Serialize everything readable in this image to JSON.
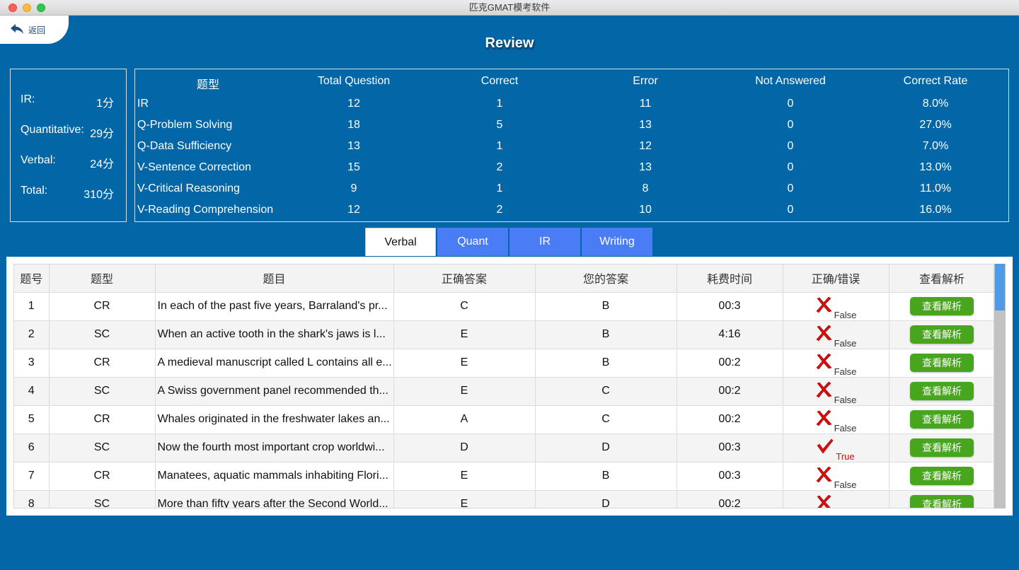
{
  "window": {
    "title": "匹克GMAT模考软件"
  },
  "back": {
    "label": "返回"
  },
  "page": {
    "title": "Review"
  },
  "scores": [
    {
      "label": "IR:",
      "value": "1分"
    },
    {
      "label": "Quantitative:",
      "value": "29分"
    },
    {
      "label": "Verbal:",
      "value": "24分"
    },
    {
      "label": "Total:",
      "value": "310分"
    }
  ],
  "stats": {
    "headers": [
      "题型",
      "Total Question",
      "Correct",
      "Error",
      "Not Answered",
      "Correct Rate"
    ],
    "rows": [
      [
        "IR",
        "12",
        "1",
        "11",
        "0",
        "8.0%"
      ],
      [
        "Q-Problem Solving",
        "18",
        "5",
        "13",
        "0",
        "27.0%"
      ],
      [
        "Q-Data Sufficiency",
        "13",
        "1",
        "12",
        "0",
        "7.0%"
      ],
      [
        "V-Sentence Correction",
        "15",
        "2",
        "13",
        "0",
        "13.0%"
      ],
      [
        "V-Critical Reasoning",
        "9",
        "1",
        "8",
        "0",
        "11.0%"
      ],
      [
        "V-Reading Comprehension",
        "12",
        "2",
        "10",
        "0",
        "16.0%"
      ]
    ]
  },
  "tabs": [
    {
      "label": "Verbal",
      "active": true
    },
    {
      "label": "Quant",
      "active": false
    },
    {
      "label": "IR",
      "active": false
    },
    {
      "label": "Writing",
      "active": false
    }
  ],
  "review": {
    "headers": [
      "题号",
      "题型",
      "题目",
      "正确答案",
      "您的答案",
      "耗费时间",
      "正确/错误",
      "查看解析"
    ],
    "view_label": "查看解析",
    "rows": [
      {
        "no": "1",
        "type": "CR",
        "question": "In each of the past five years, Barraland's pr...",
        "correct": "C",
        "yours": "B",
        "time": "00:3",
        "result": "False"
      },
      {
        "no": "2",
        "type": "SC",
        "question": "When an active tooth in the shark's jaws is l...",
        "correct": "E",
        "yours": "B",
        "time": "4:16",
        "result": "False"
      },
      {
        "no": "3",
        "type": "CR",
        "question": "A medieval manuscript called L contains all e...",
        "correct": "E",
        "yours": "B",
        "time": "00:2",
        "result": "False"
      },
      {
        "no": "4",
        "type": "SC",
        "question": "A Swiss government panel recommended th...",
        "correct": "E",
        "yours": "C",
        "time": "00:2",
        "result": "False"
      },
      {
        "no": "5",
        "type": "CR",
        "question": "Whales originated in the freshwater lakes an...",
        "correct": "A",
        "yours": "C",
        "time": "00:2",
        "result": "False"
      },
      {
        "no": "6",
        "type": "SC",
        "question": "Now the fourth most important crop worldwi...",
        "correct": "D",
        "yours": "D",
        "time": "00:3",
        "result": "True"
      },
      {
        "no": "7",
        "type": "CR",
        "question": "Manatees, aquatic mammals inhabiting Flori...",
        "correct": "E",
        "yours": "B",
        "time": "00:3",
        "result": "False"
      },
      {
        "no": "8",
        "type": "SC",
        "question": "More than fifty years after the Second World...",
        "correct": "E",
        "yours": "D",
        "time": "00:2",
        "result": "False"
      }
    ]
  },
  "colors": {
    "background": "#0367a7",
    "tab_inactive": "#4a7df5",
    "button_green": "#48a51e",
    "false_mark": "#d21010"
  }
}
